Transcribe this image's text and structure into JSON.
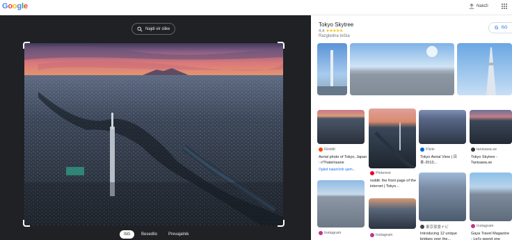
{
  "header": {
    "logo_letters": [
      {
        "ch": "G",
        "color": "#4285f4"
      },
      {
        "ch": "o",
        "color": "#ea4335"
      },
      {
        "ch": "o",
        "color": "#fbbc05"
      },
      {
        "ch": "g",
        "color": "#4285f4"
      },
      {
        "ch": "l",
        "color": "#34a853"
      },
      {
        "ch": "e",
        "color": "#ea4335"
      }
    ],
    "upload_label": "Naloži",
    "upload_icon": "upload-icon",
    "apps_icon": "apps-grid-icon"
  },
  "lens": {
    "find_source_label": "Najdi vir slike",
    "find_source_icon": "lens-search-icon",
    "modes": [
      "Išči",
      "Besedilo",
      "Prevajalnik"
    ],
    "active_mode": "Išči"
  },
  "knowledge_panel": {
    "title": "Tokyo Skytree",
    "rating": "4,4",
    "stars": "★★★★★",
    "category": "Razgledna točka",
    "search_button": "Išči"
  },
  "results": [
    {
      "source": "Reddit",
      "source_color": "#ff4500",
      "title": "Aerial photo of Tokyo, Japan : r/ThatsInsane",
      "sub": "Ogled natančnih ujem..."
    },
    {
      "source": "Pinterest",
      "source_color": "#e60023",
      "title": "reddit: the front page of the internet | Tokyo...",
      "sub": ""
    },
    {
      "source": "Flickr",
      "source_color": "#0063dc",
      "title": "Tokyo Aerial View | 日本-2013...",
      "sub": ""
    },
    {
      "source": "tanisawa.se",
      "source_color": "#333333",
      "title": "Tokyo Skytree - Tanisawa.se",
      "sub": ""
    },
    {
      "source": "東京夜景ナビ",
      "source_color": "#444444",
      "title": "Introducing 12 unique bridges over the...",
      "sub": ""
    },
    {
      "source": "Instagram",
      "source_color": "#c13584",
      "title": "Gaya Travel Magazine - Let's spend one whole...",
      "sub": ""
    },
    {
      "source": "Instagram",
      "source_color": "#c13584",
      "title": "",
      "sub": ""
    },
    {
      "source": "Instagram",
      "source_color": "#c13584",
      "title": "",
      "sub": ""
    }
  ]
}
